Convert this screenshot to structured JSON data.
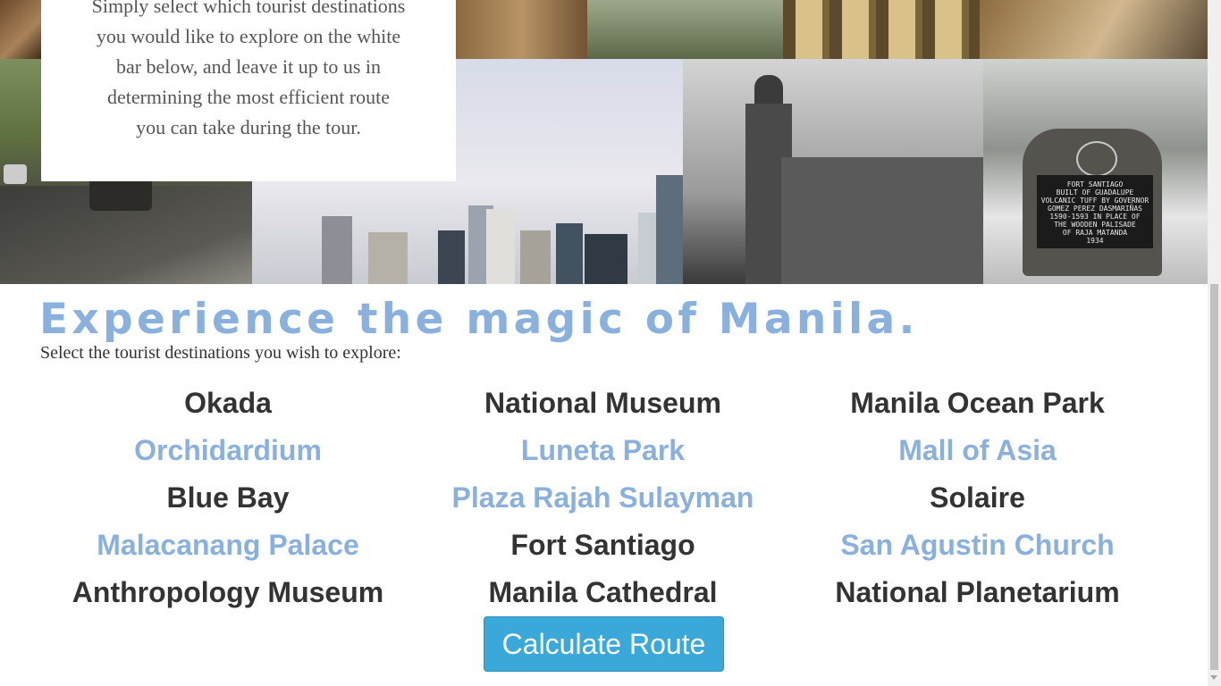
{
  "intro": {
    "lines": [
      "Simply select which tourist destinations",
      "you would like to explore on the white",
      "bar below, and leave it up to us in",
      "determining the most efficient route",
      "you can take during the tour."
    ]
  },
  "collage": {
    "plaque_lines": [
      "FORT SANTIAGO",
      "BUILT OF GUADALUPE",
      "VOLCANIC TUFF BY GOVERNOR",
      "GOMEZ PEREZ DASMARIÑAS",
      "1590-1593 IN PLACE OF",
      "THE WOODEN PALISADE",
      "OF RAJA MATANDA",
      "1934"
    ]
  },
  "headline": "Experience the magic of Manila.",
  "subhead": "Select the tourist destinations you wish to explore:",
  "destinations": [
    {
      "label": "Okada",
      "state": "unselected"
    },
    {
      "label": "National Museum",
      "state": "unselected"
    },
    {
      "label": "Manila Ocean Park",
      "state": "unselected"
    },
    {
      "label": "Orchidardium",
      "state": "selected"
    },
    {
      "label": "Luneta Park",
      "state": "selected"
    },
    {
      "label": "Mall of Asia",
      "state": "selected"
    },
    {
      "label": "Blue Bay",
      "state": "unselected"
    },
    {
      "label": "Plaza Rajah Sulayman",
      "state": "selected"
    },
    {
      "label": "Solaire",
      "state": "unselected"
    },
    {
      "label": "Malacanang Palace",
      "state": "selected"
    },
    {
      "label": "Fort Santiago",
      "state": "unselected"
    },
    {
      "label": "San Agustin Church",
      "state": "selected"
    },
    {
      "label": "Anthropology Museum",
      "state": "unselected"
    },
    {
      "label": "Manila Cathedral",
      "state": "unselected"
    },
    {
      "label": "National Planetarium",
      "state": "unselected"
    }
  ],
  "button": {
    "label": "Calculate Route"
  },
  "colors": {
    "accent": "#8ab1de",
    "text": "#333333",
    "button": "#3aa8d8"
  }
}
